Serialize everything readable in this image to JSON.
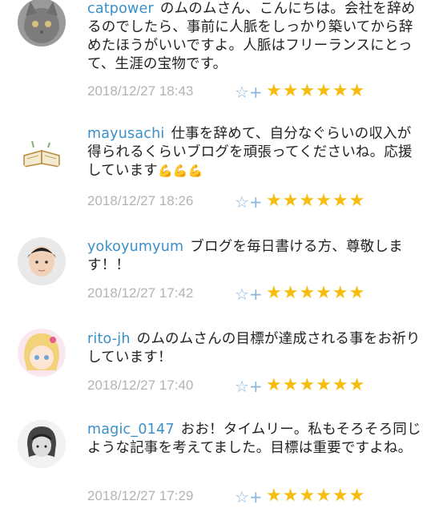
{
  "colors": {
    "username": "#3b8fc8",
    "timestamp": "#b3b3b3",
    "star": "#f6bd0f",
    "add_star": "#8ab5dc"
  },
  "comments": [
    {
      "user": "catpower",
      "text": "のムのムさん、こんにちは。会社を辞めるのでしたら、事前に人脈をしっかり築いてから辞めたほうがいいですよ。人脈はフリーランスにとって、生涯の宝物です。",
      "timestamp": "2018/12/27 18:43",
      "add_star": "☆+",
      "stars": "★★★★★★",
      "avatar_icon": "cat-avatar-icon"
    },
    {
      "user": "mayusachi",
      "text": "仕事を辞めて、自分なぐらいの収入が得られるくらいブログを頑張ってくださいね。応援しています",
      "emoji": "💪💪💪",
      "timestamp": "2018/12/27 18:26",
      "add_star": "☆+",
      "stars": "★★★★★★",
      "avatar_icon": "book-avatar-icon"
    },
    {
      "user": "yokoyumyum",
      "text": "ブログを毎日書ける方、尊敬します！！",
      "timestamp": "2018/12/27 17:42",
      "add_star": "☆+",
      "stars": "★★★★★★",
      "avatar_icon": "person-avatar-icon"
    },
    {
      "user": "rito-jh",
      "text": "のムのムさんの目標が達成される事をお祈りしています！",
      "timestamp": "2018/12/27 17:40",
      "add_star": "☆+",
      "stars": "★★★★★★",
      "avatar_icon": "anime-avatar-icon"
    },
    {
      "user": "magic_0147",
      "text": "おお！タイムリー。私もそろそろ同じような記事を考えてました。目標は重要ですよね。",
      "timestamp": "2018/12/27 17:29",
      "add_star": "☆+",
      "stars": "★★★★★★",
      "avatar_icon": "sketch-avatar-icon"
    }
  ]
}
